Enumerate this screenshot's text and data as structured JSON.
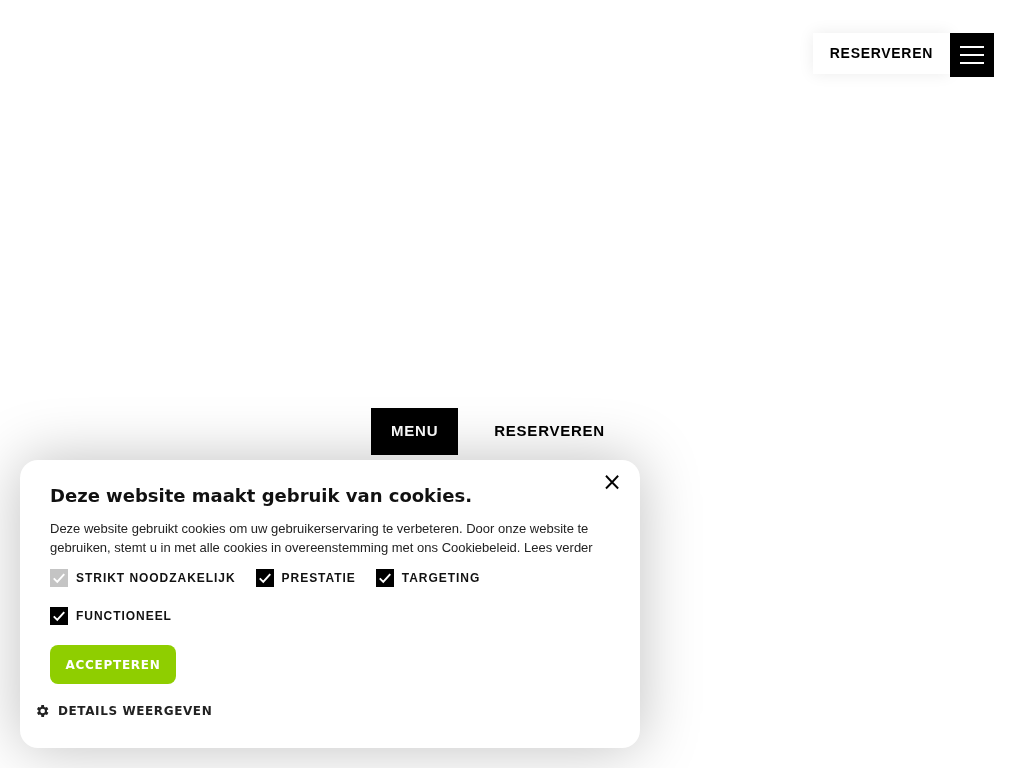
{
  "header": {
    "reserve_button": "RESERVEREN"
  },
  "nav_tabs": [
    {
      "label": "MENU",
      "selected": true
    },
    {
      "label": "RESERVEREN",
      "selected": false
    }
  ],
  "cookie_dialog": {
    "close": "×",
    "title": "Deze website maakt gebruik van cookies.",
    "body": "Deze website gebruikt cookies om uw gebruikerservaring te verbeteren. Door onze website te gebruiken, stemt u in met alle cookies in overeenstemming met ons Cookiebeleid.",
    "link": "Lees verder",
    "options": [
      {
        "label": "STRIKT NOODZAKELIJK",
        "checked": true,
        "disabled": true
      },
      {
        "label": "PRESTATIE",
        "checked": true,
        "disabled": false
      },
      {
        "label": "TARGETING",
        "checked": true,
        "disabled": false
      },
      {
        "label": "FUNCTIONEEL",
        "checked": true,
        "disabled": false
      }
    ],
    "accept_button": "ACCEPTEREN",
    "details_link": "DETAILS WEERGEVEN"
  }
}
